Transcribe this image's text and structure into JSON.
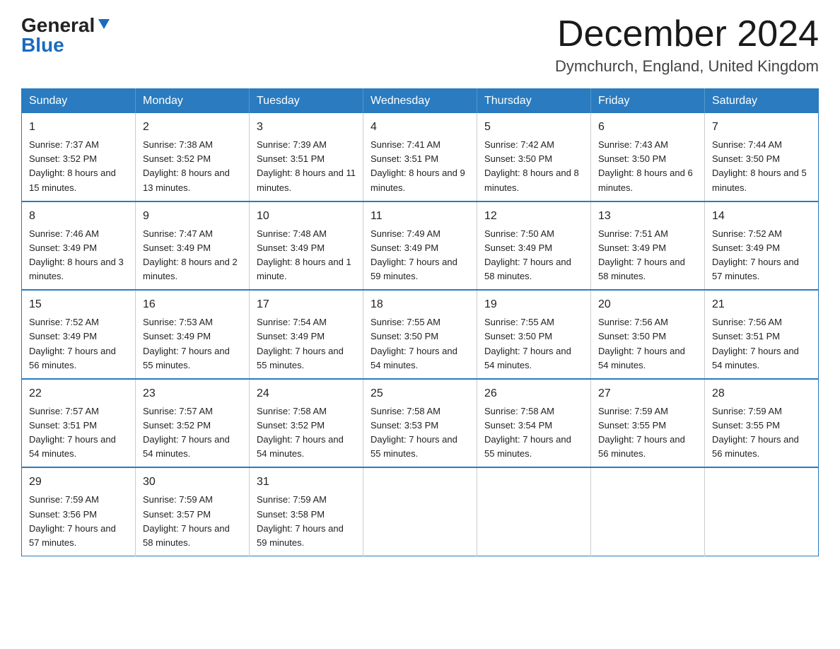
{
  "header": {
    "logo_line1": "General",
    "logo_line2": "Blue",
    "month_title": "December 2024",
    "location": "Dymchurch, England, United Kingdom"
  },
  "days_of_week": [
    "Sunday",
    "Monday",
    "Tuesday",
    "Wednesday",
    "Thursday",
    "Friday",
    "Saturday"
  ],
  "weeks": [
    [
      {
        "day": "1",
        "sunrise": "7:37 AM",
        "sunset": "3:52 PM",
        "daylight": "8 hours and 15 minutes."
      },
      {
        "day": "2",
        "sunrise": "7:38 AM",
        "sunset": "3:52 PM",
        "daylight": "8 hours and 13 minutes."
      },
      {
        "day": "3",
        "sunrise": "7:39 AM",
        "sunset": "3:51 PM",
        "daylight": "8 hours and 11 minutes."
      },
      {
        "day": "4",
        "sunrise": "7:41 AM",
        "sunset": "3:51 PM",
        "daylight": "8 hours and 9 minutes."
      },
      {
        "day": "5",
        "sunrise": "7:42 AM",
        "sunset": "3:50 PM",
        "daylight": "8 hours and 8 minutes."
      },
      {
        "day": "6",
        "sunrise": "7:43 AM",
        "sunset": "3:50 PM",
        "daylight": "8 hours and 6 minutes."
      },
      {
        "day": "7",
        "sunrise": "7:44 AM",
        "sunset": "3:50 PM",
        "daylight": "8 hours and 5 minutes."
      }
    ],
    [
      {
        "day": "8",
        "sunrise": "7:46 AM",
        "sunset": "3:49 PM",
        "daylight": "8 hours and 3 minutes."
      },
      {
        "day": "9",
        "sunrise": "7:47 AM",
        "sunset": "3:49 PM",
        "daylight": "8 hours and 2 minutes."
      },
      {
        "day": "10",
        "sunrise": "7:48 AM",
        "sunset": "3:49 PM",
        "daylight": "8 hours and 1 minute."
      },
      {
        "day": "11",
        "sunrise": "7:49 AM",
        "sunset": "3:49 PM",
        "daylight": "7 hours and 59 minutes."
      },
      {
        "day": "12",
        "sunrise": "7:50 AM",
        "sunset": "3:49 PM",
        "daylight": "7 hours and 58 minutes."
      },
      {
        "day": "13",
        "sunrise": "7:51 AM",
        "sunset": "3:49 PM",
        "daylight": "7 hours and 58 minutes."
      },
      {
        "day": "14",
        "sunrise": "7:52 AM",
        "sunset": "3:49 PM",
        "daylight": "7 hours and 57 minutes."
      }
    ],
    [
      {
        "day": "15",
        "sunrise": "7:52 AM",
        "sunset": "3:49 PM",
        "daylight": "7 hours and 56 minutes."
      },
      {
        "day": "16",
        "sunrise": "7:53 AM",
        "sunset": "3:49 PM",
        "daylight": "7 hours and 55 minutes."
      },
      {
        "day": "17",
        "sunrise": "7:54 AM",
        "sunset": "3:49 PM",
        "daylight": "7 hours and 55 minutes."
      },
      {
        "day": "18",
        "sunrise": "7:55 AM",
        "sunset": "3:50 PM",
        "daylight": "7 hours and 54 minutes."
      },
      {
        "day": "19",
        "sunrise": "7:55 AM",
        "sunset": "3:50 PM",
        "daylight": "7 hours and 54 minutes."
      },
      {
        "day": "20",
        "sunrise": "7:56 AM",
        "sunset": "3:50 PM",
        "daylight": "7 hours and 54 minutes."
      },
      {
        "day": "21",
        "sunrise": "7:56 AM",
        "sunset": "3:51 PM",
        "daylight": "7 hours and 54 minutes."
      }
    ],
    [
      {
        "day": "22",
        "sunrise": "7:57 AM",
        "sunset": "3:51 PM",
        "daylight": "7 hours and 54 minutes."
      },
      {
        "day": "23",
        "sunrise": "7:57 AM",
        "sunset": "3:52 PM",
        "daylight": "7 hours and 54 minutes."
      },
      {
        "day": "24",
        "sunrise": "7:58 AM",
        "sunset": "3:52 PM",
        "daylight": "7 hours and 54 minutes."
      },
      {
        "day": "25",
        "sunrise": "7:58 AM",
        "sunset": "3:53 PM",
        "daylight": "7 hours and 55 minutes."
      },
      {
        "day": "26",
        "sunrise": "7:58 AM",
        "sunset": "3:54 PM",
        "daylight": "7 hours and 55 minutes."
      },
      {
        "day": "27",
        "sunrise": "7:59 AM",
        "sunset": "3:55 PM",
        "daylight": "7 hours and 56 minutes."
      },
      {
        "day": "28",
        "sunrise": "7:59 AM",
        "sunset": "3:55 PM",
        "daylight": "7 hours and 56 minutes."
      }
    ],
    [
      {
        "day": "29",
        "sunrise": "7:59 AM",
        "sunset": "3:56 PM",
        "daylight": "7 hours and 57 minutes."
      },
      {
        "day": "30",
        "sunrise": "7:59 AM",
        "sunset": "3:57 PM",
        "daylight": "7 hours and 58 minutes."
      },
      {
        "day": "31",
        "sunrise": "7:59 AM",
        "sunset": "3:58 PM",
        "daylight": "7 hours and 59 minutes."
      },
      null,
      null,
      null,
      null
    ]
  ],
  "labels": {
    "sunrise": "Sunrise:",
    "sunset": "Sunset:",
    "daylight": "Daylight:"
  }
}
